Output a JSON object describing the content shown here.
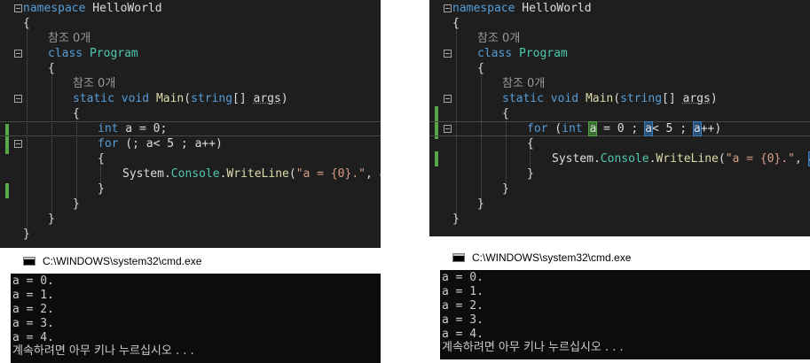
{
  "left": {
    "editor": {
      "namespace_kw": "namespace",
      "namespace_name": "HelloWorld",
      "open_brace": "{",
      "close_brace": "}",
      "refs_class": "참조 0개",
      "class_kw": "class",
      "class_name": "Program",
      "refs_method": "참조 0개",
      "static_kw": "static",
      "void_kw": "void",
      "method_name": "Main",
      "param_open": "(",
      "string_kw": "string",
      "param_rest": "[] ",
      "args": "args",
      "param_close": ")",
      "int_kw": "int",
      "decl_rest": " a = 0;",
      "for_kw": "for",
      "for_rest": " (; a< 5 ; a++)",
      "sys": "System",
      "dot": ".",
      "console": "Console",
      "writeline": "WriteLine",
      "call_open": "(",
      "str_lit": "\"a = {0}.\"",
      "call_rest": ", a);"
    },
    "cmd_title": "C:\\WINDOWS\\system32\\cmd.exe",
    "output": [
      "a = 0.",
      "a = 1.",
      "a = 2.",
      "a = 3.",
      "a = 4.",
      "계속하려면 아무 키나 누르십시오 . . ."
    ]
  },
  "right": {
    "editor": {
      "namespace_kw": "namespace",
      "namespace_name": "HelloWorld",
      "open_brace": "{",
      "close_brace": "}",
      "refs_class": "참조 0개",
      "class_kw": "class",
      "class_name": "Program",
      "refs_method": "참조 0개",
      "static_kw": "static",
      "void_kw": "void",
      "method_name": "Main",
      "param_open": "(",
      "string_kw": "string",
      "param_rest": "[] ",
      "args": "args",
      "param_close": ")",
      "for_kw": "for",
      "for_open": " (",
      "int_kw": "int",
      "space": " ",
      "a": "a",
      "init_rest": " = 0 ; ",
      "cond_rest": "< 5 ; ",
      "incr_rest": "++)",
      "sys": "System",
      "dot": ".",
      "console": "Console",
      "writeline": "WriteLine",
      "call_open": "(",
      "str_lit": "\"a = {0}.\"",
      "comma": ", ",
      "call_close": ");"
    },
    "cmd_title": "C:\\WINDOWS\\system32\\cmd.exe",
    "output": [
      "a = 0.",
      "a = 1.",
      "a = 2.",
      "a = 3.",
      "a = 4.",
      "계속하려면 아무 키나 누르십시오 . . ."
    ]
  }
}
